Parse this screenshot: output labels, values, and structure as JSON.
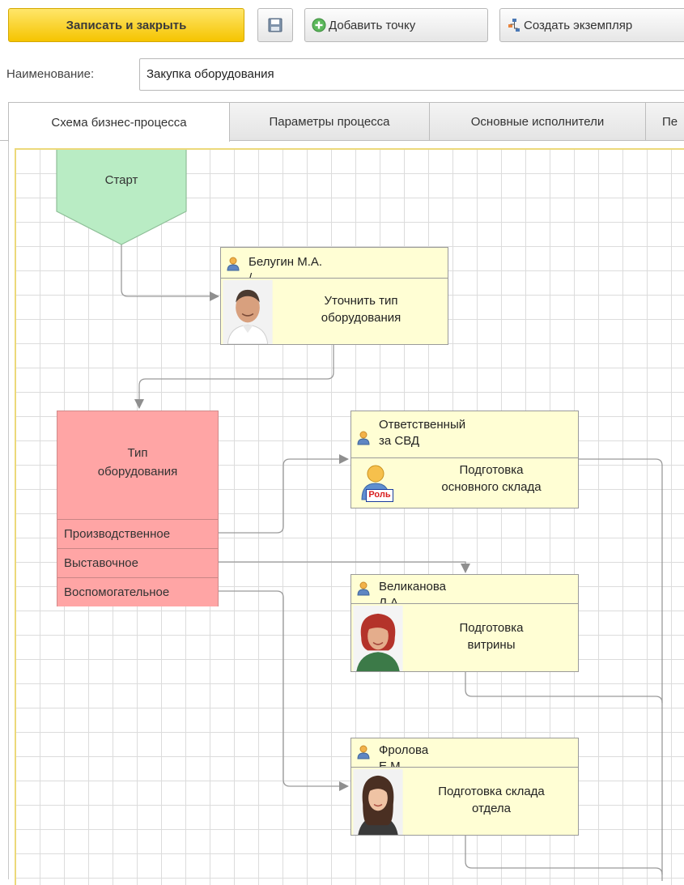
{
  "toolbar": {
    "save_close": "Записать и закрыть",
    "save_icon": "floppy-disk-icon",
    "add_point": "Добавить точку",
    "create_instance": "Создать экземпляр"
  },
  "form": {
    "name_label": "Наименование:",
    "name_value": "Закупка оборудования"
  },
  "tabs": [
    {
      "label": "Схема бизнес-процесса",
      "active": true
    },
    {
      "label": "Параметры процесса"
    },
    {
      "label": "Основные исполнители"
    },
    {
      "label": "Пе"
    }
  ],
  "diagram": {
    "start": {
      "label": "Старт",
      "color": "#b9ecc4"
    },
    "task1": {
      "assignee": "Белугин М.А.",
      "assignee_cut": "/",
      "title_l1": "Уточнить тип",
      "title_l2": "оборудования"
    },
    "decision": {
      "title_l1": "Тип",
      "title_l2": "оборудования",
      "branches": [
        "Производственное",
        "Выставочное",
        "Воспомогательное"
      ],
      "color": "#ffa5a5"
    },
    "task2": {
      "assignee_l1": "Ответственный",
      "assignee_l2": "за СВД",
      "role_badge": "Роль",
      "title_l1": "Подготовка",
      "title_l2": "основного склада"
    },
    "task3": {
      "assignee": "Великанова",
      "assignee_cut": "Л.А.",
      "title_l1": "Подготовка",
      "title_l2": "витрины"
    },
    "task4": {
      "assignee": "Фролова",
      "assignee_cut": "Е.М.",
      "title_l1": "Подготовка склада",
      "title_l2": "отдела"
    },
    "task_color": "#fffed4"
  }
}
